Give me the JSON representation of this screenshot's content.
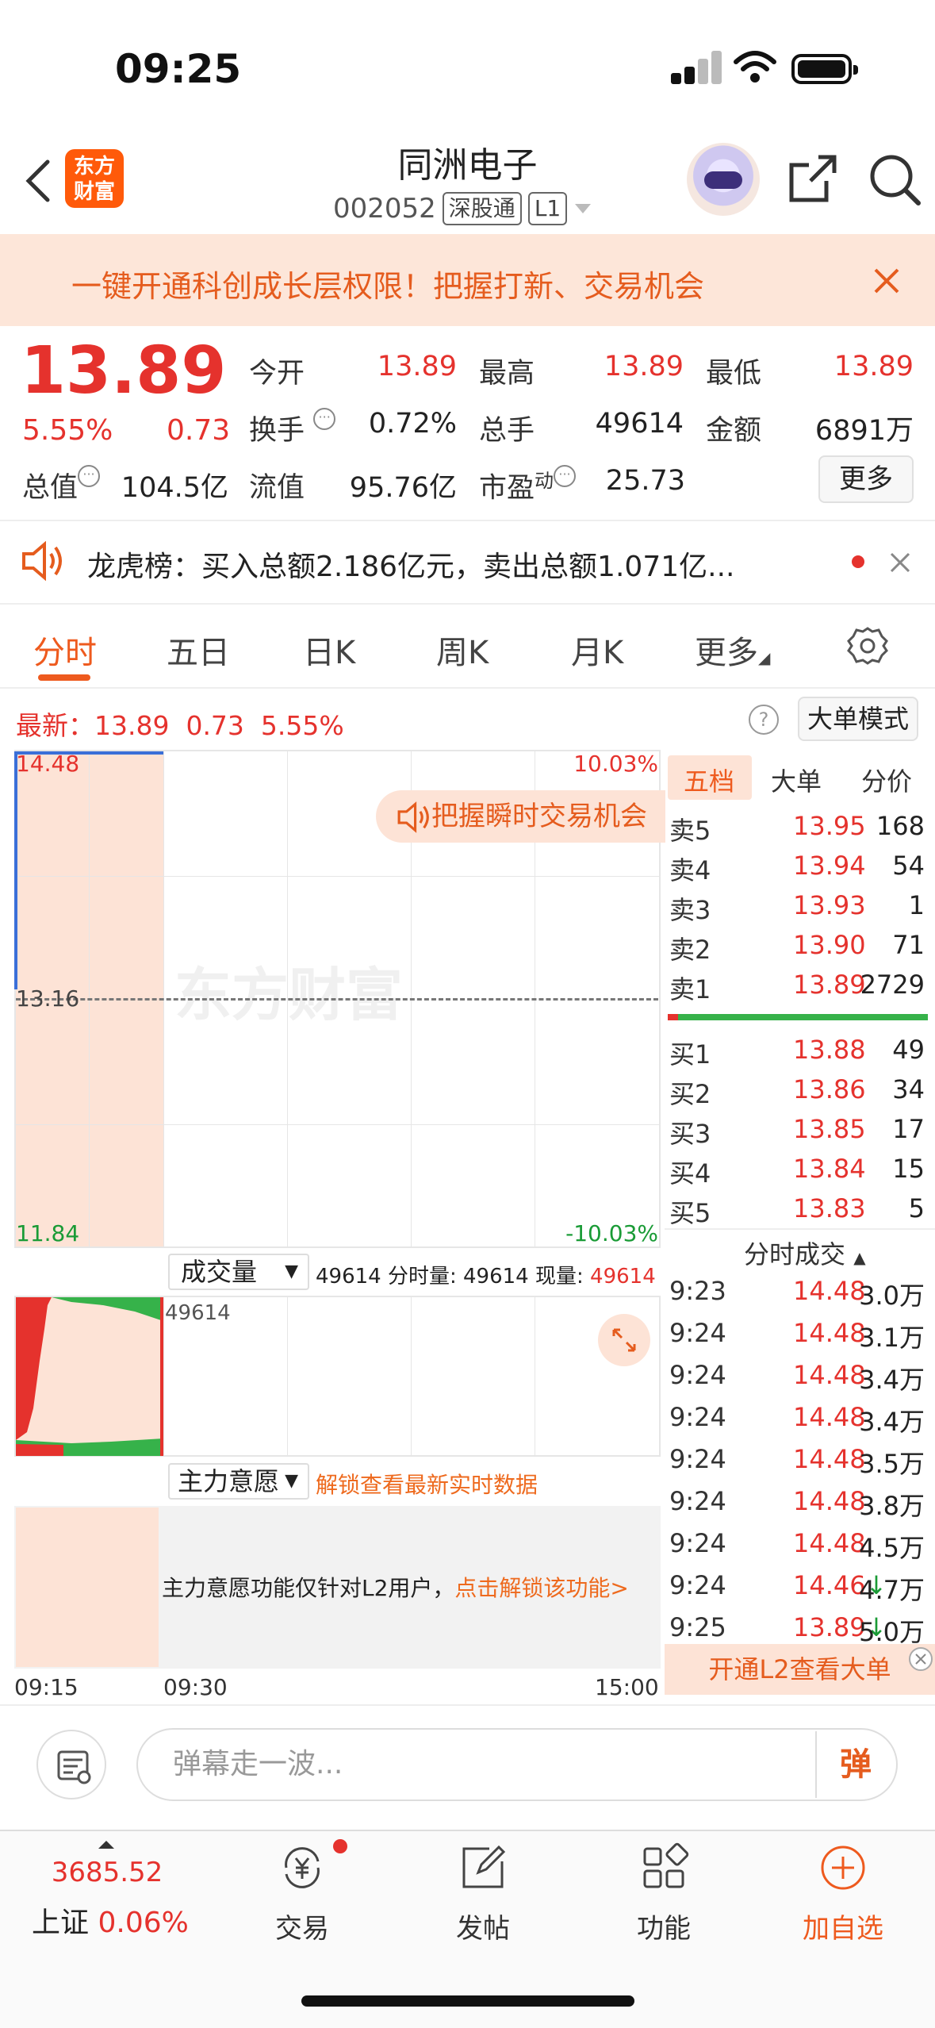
{
  "status": {
    "time": "09:25"
  },
  "header": {
    "logo_line1": "东方",
    "logo_line2": "财富",
    "stock_name": "同洲电子",
    "stock_code": "002052",
    "market_tag": "深股通",
    "level_tag": "L1"
  },
  "banner": {
    "text": "一键开通科创成长层权限！把握打新、交易机会"
  },
  "quote": {
    "price": "13.89",
    "change_pct": "5.55%",
    "change": "0.73",
    "open_label": "今开",
    "open": "13.89",
    "high_label": "最高",
    "high": "13.89",
    "low_label": "最低",
    "low": "13.89",
    "turnover_label": "换手",
    "turnover": "0.72%",
    "volume_label": "总手",
    "volume": "49614",
    "amount_label": "金额",
    "amount": "6891万",
    "mktcap_label": "总值",
    "mktcap": "104.5亿",
    "float_label": "流值",
    "float": "95.76亿",
    "pe_label": "市盈",
    "pe_sup": "动",
    "pe": "25.73",
    "more": "更多"
  },
  "dragon_tiger": {
    "text": "龙虎榜：买入总额2.186亿元，卖出总额1.071亿..."
  },
  "tabs": [
    "分时",
    "五日",
    "日K",
    "周K",
    "月K",
    "更多"
  ],
  "latest": {
    "text": "最新：13.89  0.73  5.55%"
  },
  "big_mode": "大单模式",
  "chart": {
    "y_high": "14.48",
    "y_mid": "13.16",
    "y_low": "11.84",
    "pct_high": "10.03%",
    "pct_low": "-10.03%",
    "watermark": "东方财富",
    "promo": "把握瞬时交易机会",
    "times": [
      "09:15",
      "09:30",
      "15:00"
    ]
  },
  "volume": {
    "select_label": "成交量",
    "value_a": "49614",
    "fs_label": "分时量:",
    "fs_value": "49614",
    "now_label": "现量:",
    "now_value": "49614",
    "axis_value": "49614"
  },
  "intent": {
    "select_label": "主力意愿",
    "unlock_text": "解锁查看最新实时数据",
    "note": "主力意愿功能仅针对L2用户，",
    "note_link": "点击解锁该功能>"
  },
  "order_book": {
    "tabs": [
      "五档",
      "大单",
      "分价"
    ],
    "asks": [
      {
        "label": "卖5",
        "price": "13.95",
        "vol": "168"
      },
      {
        "label": "卖4",
        "price": "13.94",
        "vol": "54"
      },
      {
        "label": "卖3",
        "price": "13.93",
        "vol": "1"
      },
      {
        "label": "卖2",
        "price": "13.90",
        "vol": "71"
      },
      {
        "label": "卖1",
        "price": "13.89",
        "vol": "2729"
      }
    ],
    "bids": [
      {
        "label": "买1",
        "price": "13.88",
        "vol": "49"
      },
      {
        "label": "买2",
        "price": "13.86",
        "vol": "34"
      },
      {
        "label": "买3",
        "price": "13.85",
        "vol": "17"
      },
      {
        "label": "买4",
        "price": "13.84",
        "vol": "15"
      },
      {
        "label": "买5",
        "price": "13.83",
        "vol": "5"
      }
    ]
  },
  "trades": {
    "title": "分时成交",
    "rows": [
      {
        "t": "9:23",
        "p": "14.48",
        "v": "3.0万",
        "arrow": ""
      },
      {
        "t": "9:24",
        "p": "14.48",
        "v": "3.1万",
        "arrow": ""
      },
      {
        "t": "9:24",
        "p": "14.48",
        "v": "3.4万",
        "arrow": ""
      },
      {
        "t": "9:24",
        "p": "14.48",
        "v": "3.4万",
        "arrow": ""
      },
      {
        "t": "9:24",
        "p": "14.48",
        "v": "3.5万",
        "arrow": ""
      },
      {
        "t": "9:24",
        "p": "14.48",
        "v": "3.8万",
        "arrow": ""
      },
      {
        "t": "9:24",
        "p": "14.48",
        "v": "4.5万",
        "arrow": ""
      },
      {
        "t": "9:24",
        "p": "14.46",
        "v": "4.7万",
        "arrow": "↓"
      },
      {
        "t": "9:25",
        "p": "13.89",
        "v": "5.0万",
        "arrow": "↓"
      }
    ],
    "l2_button": "开通L2查看大单"
  },
  "comment": {
    "placeholder": "弹幕走一波...",
    "send": "弹"
  },
  "nav": {
    "index_value": "3685.52",
    "index_name": "上证",
    "index_pct": "0.06%",
    "trade": "交易",
    "post": "发帖",
    "func": "功能",
    "add": "加自选"
  },
  "colors": {
    "up": "#e5322d",
    "down": "#1a9b36",
    "accent": "#ee5a1e",
    "banner_bg": "#fde6d9"
  }
}
